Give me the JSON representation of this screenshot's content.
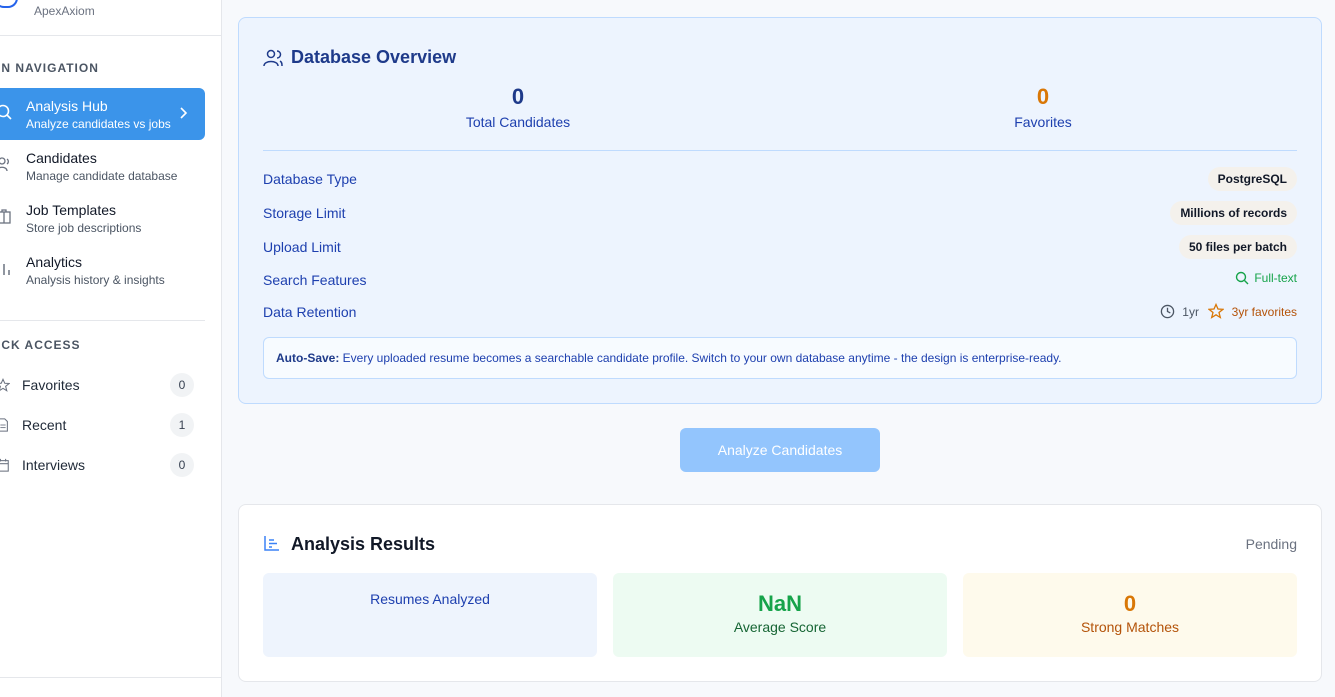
{
  "sidebar": {
    "brand_name": "ApexAxiom",
    "main_nav_title": "IN NAVIGATION",
    "nav_items": [
      {
        "label": "Analysis Hub",
        "sub": "Analyze candidates vs jobs",
        "icon": "search-icon",
        "active": true
      },
      {
        "label": "Candidates",
        "sub": "Manage candidate database",
        "icon": "users-icon",
        "active": false
      },
      {
        "label": "Job Templates",
        "sub": "Store job descriptions",
        "icon": "building-icon",
        "active": false
      },
      {
        "label": "Analytics",
        "sub": "Analysis history & insights",
        "icon": "bar-chart-icon",
        "active": false
      }
    ],
    "quick_access_title": "ICK ACCESS",
    "quick_items": [
      {
        "label": "Favorites",
        "count": "0",
        "icon": "star-icon"
      },
      {
        "label": "Recent",
        "count": "1",
        "icon": "file-icon"
      },
      {
        "label": "Interviews",
        "count": "0",
        "icon": "calendar-icon"
      }
    ]
  },
  "overview": {
    "title": "Database Overview",
    "total_candidates_value": "0",
    "total_candidates_label": "Total Candidates",
    "favorites_value": "0",
    "favorites_label": "Favorites",
    "rows": [
      {
        "label": "Database Type",
        "value": "PostgreSQL"
      },
      {
        "label": "Storage Limit",
        "value": "Millions of records"
      },
      {
        "label": "Upload Limit",
        "value": "50 files per batch"
      },
      {
        "label": "Search Features",
        "value": "Full-text"
      },
      {
        "label": "Data Retention",
        "value_1": "1yr",
        "value_2": "3yr favorites"
      }
    ],
    "notice_bold": "Auto-Save:",
    "notice_text": " Every uploaded resume becomes a searchable candidate profile. Switch to your own database anytime - the design is enterprise-ready.",
    "colors": {
      "accent_blue": "#1e3a8a",
      "amber": "#d97706",
      "green": "#16a34a"
    }
  },
  "analyze_button_label": "Analyze Candidates",
  "results": {
    "title": "Analysis Results",
    "status": "Pending",
    "cards": [
      {
        "value": "",
        "label": "Resumes Analyzed"
      },
      {
        "value": "NaN",
        "label": "Average Score"
      },
      {
        "value": "0",
        "label": "Strong Matches"
      }
    ]
  }
}
